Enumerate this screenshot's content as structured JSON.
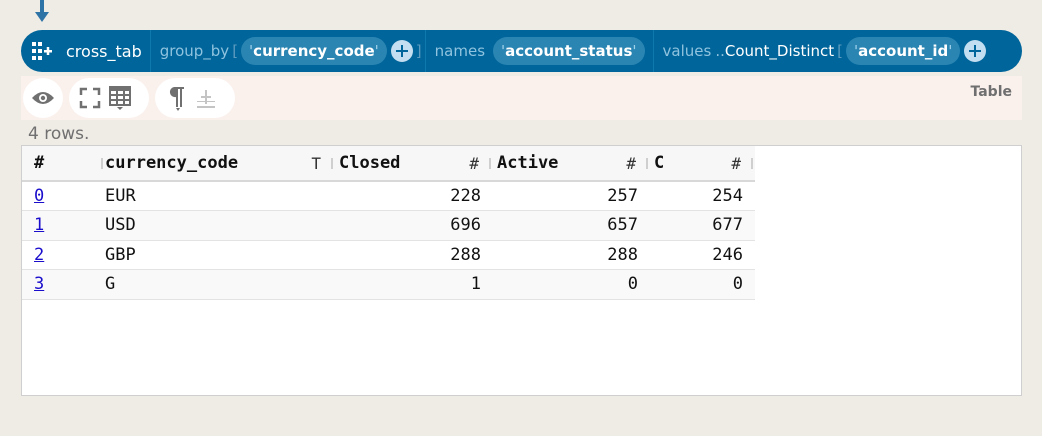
{
  "pipeline": {
    "command": "cross_tab",
    "group_by_kw": "group_by",
    "open_bracket": "[",
    "close_bracket": "]",
    "group_by_value": "currency_code",
    "names_kw": "names",
    "names_value": "account_status",
    "values_kw": "values",
    "values_dots": "..",
    "values_fn": "Count_Distinct",
    "values_value": "account_id",
    "quote": "'"
  },
  "toolbar": {
    "view_label": "Table"
  },
  "result": {
    "rows_info": "4 rows."
  },
  "table": {
    "columns": [
      {
        "label": "#",
        "type_glyph": ""
      },
      {
        "label": "currency_code",
        "type_glyph": "T"
      },
      {
        "label": "Closed",
        "type_glyph": "#"
      },
      {
        "label": "Active",
        "type_glyph": "#"
      },
      {
        "label": "C",
        "type_glyph": "#"
      }
    ],
    "rows": [
      {
        "index": "0",
        "currency_code": "EUR",
        "closed": "228",
        "active": "257",
        "c": "254"
      },
      {
        "index": "1",
        "currency_code": "USD",
        "closed": "696",
        "active": "657",
        "c": "677"
      },
      {
        "index": "2",
        "currency_code": "GBP",
        "closed": "288",
        "active": "288",
        "c": "246"
      },
      {
        "index": "3",
        "currency_code": "G",
        "closed": "1",
        "active": "0",
        "c": "0"
      }
    ]
  },
  "colors": {
    "pipe_bar": "#00659a",
    "pill": "#2a85b3",
    "background": "#efebe5",
    "toolbar": "#faf0ec"
  },
  "icons": {
    "arrow": "down-arrow-icon",
    "command": "grid-plus-icon",
    "add": "plus-circle-icon",
    "eye": "eye-icon",
    "expand": "expand-icon",
    "table": "table-icon",
    "paragraph": "pilcrow-icon",
    "add_row": "insert-row-icon"
  }
}
